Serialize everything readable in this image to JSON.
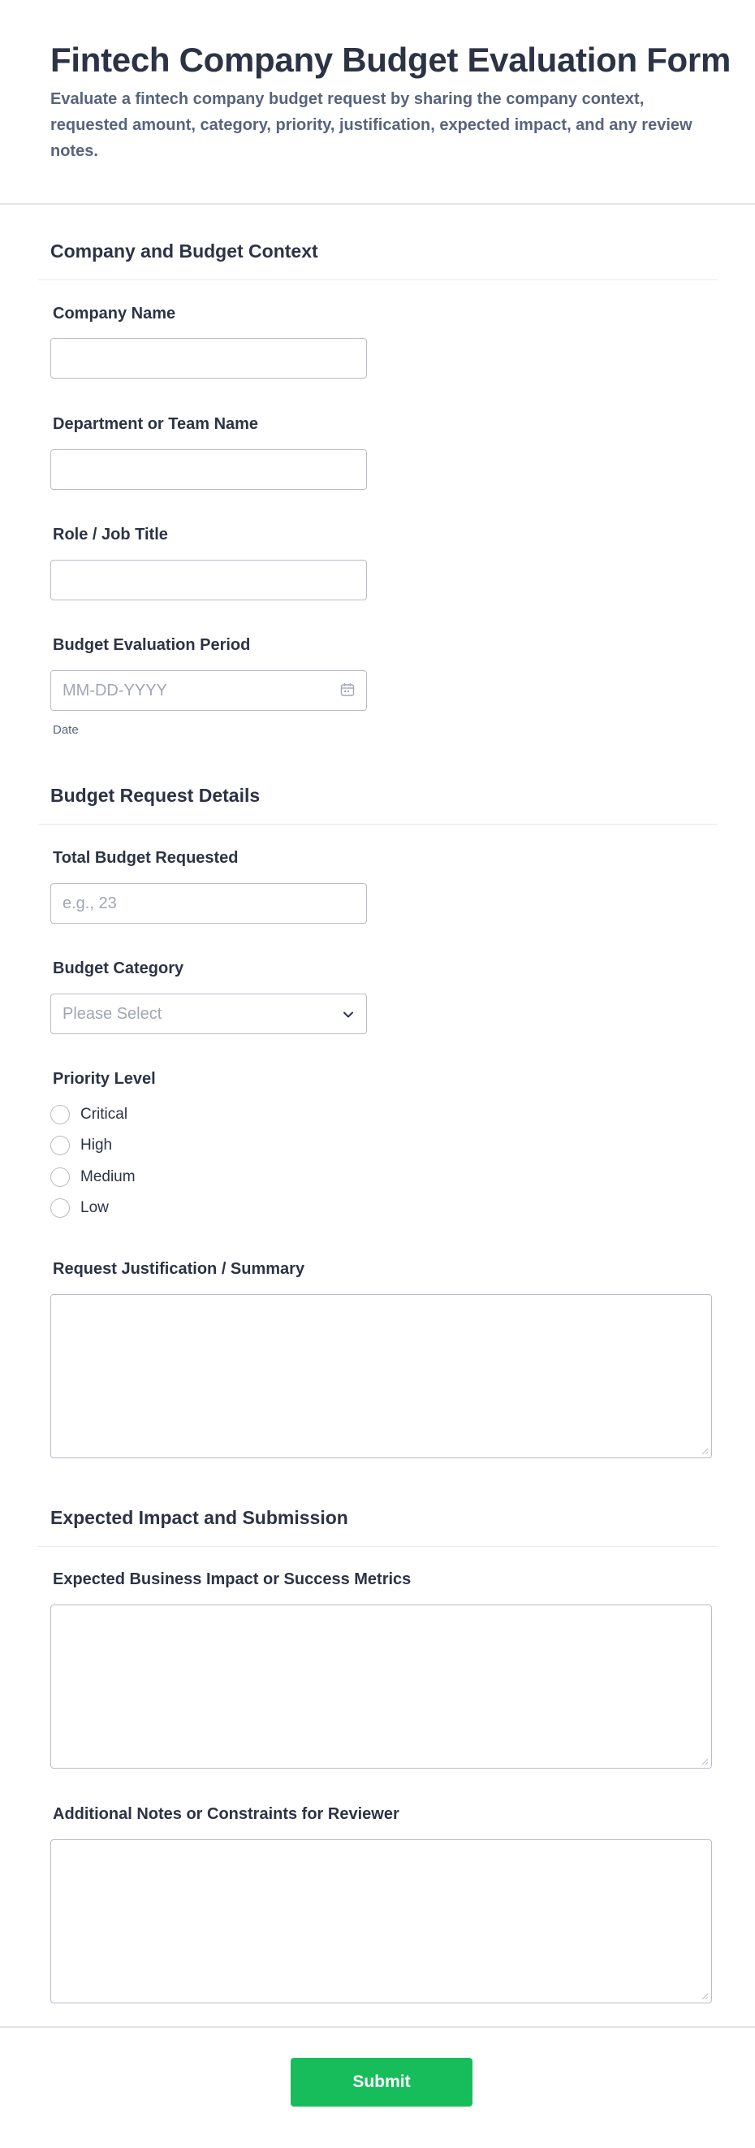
{
  "form": {
    "title": "Fintech Company Budget Evaluation Form",
    "description": "Evaluate a fintech company budget request by sharing the company context, requested amount, category, priority, justification, expected impact, and any review notes."
  },
  "sections": {
    "context": {
      "title": "Company and Budget Context"
    },
    "details": {
      "title": "Budget Request Details"
    },
    "impact": {
      "title": "Expected Impact and Submission"
    }
  },
  "fields": {
    "company_name": {
      "label": "Company Name",
      "value": ""
    },
    "department": {
      "label": "Department or Team Name",
      "value": ""
    },
    "role": {
      "label": "Role / Job Title",
      "value": ""
    },
    "period": {
      "label": "Budget Evaluation Period",
      "placeholder": "MM-DD-YYYY",
      "sublabel": "Date",
      "icon": "calendar-icon"
    },
    "total_budget": {
      "label": "Total Budget Requested",
      "placeholder": "e.g., 23"
    },
    "category": {
      "label": "Budget Category",
      "selected": "Please Select",
      "icon": "chevron-down-icon"
    },
    "priority": {
      "label": "Priority Level",
      "options": [
        "Critical",
        "High",
        "Medium",
        "Low"
      ]
    },
    "justification": {
      "label": "Request Justification / Summary"
    },
    "business_impact": {
      "label": "Expected Business Impact or Success Metrics"
    },
    "notes": {
      "label": "Additional Notes or Constraints for Reviewer"
    }
  },
  "submit": {
    "label": "Submit"
  },
  "colors": {
    "accent": "#18bd5b",
    "text": "#2c3345",
    "muted": "#57647e",
    "border": "#b8bdc9"
  }
}
